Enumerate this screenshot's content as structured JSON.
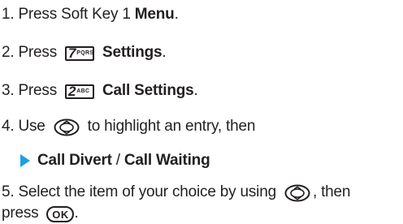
{
  "steps": [
    {
      "number": "1.",
      "pre": "Press Soft Key 1",
      "bold": "Menu",
      "post": "."
    },
    {
      "number": "2.",
      "pre": "Press",
      "key": {
        "digit": "7",
        "letters": "PQRS",
        "icon": "key-7-pqrs-icon"
      },
      "bold": "Settings",
      "post": "."
    },
    {
      "number": "3.",
      "pre": "Press",
      "key": {
        "digit": "2",
        "letters": "ABC",
        "icon": "key-2-abc-icon"
      },
      "bold": "Call Settings",
      "post": "."
    },
    {
      "number": "4.",
      "pre": "Use",
      "icon": "navigation-key-icon",
      "post": "to highlight an entry, then"
    },
    {
      "sub_item": {
        "icon": "arrow-right-icon",
        "label_a": "Call Divert",
        "separator": "/",
        "label_b": "Call Waiting"
      }
    },
    {
      "number": "5.",
      "pre": "Select the item of your choice by using",
      "icon": "navigation-key-icon",
      "post": ", then",
      "line2_pre": "press",
      "ok_label": "OK",
      "line2_post": "."
    }
  ],
  "colors": {
    "text": "#231f20",
    "accent_arrow": "#1e9fe0"
  }
}
